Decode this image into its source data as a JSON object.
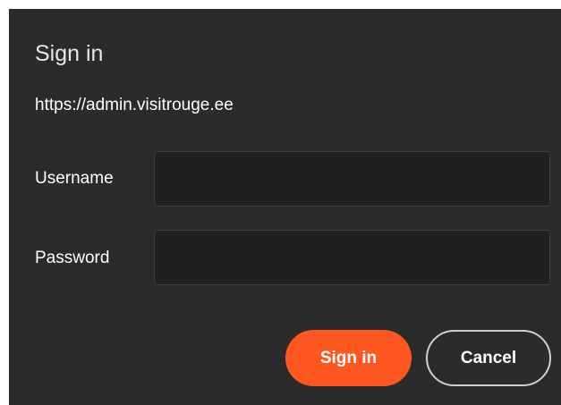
{
  "dialog": {
    "title": "Sign in",
    "url": "https://admin.visitrouge.ee",
    "username": {
      "label": "Username",
      "value": "",
      "placeholder": ""
    },
    "password": {
      "label": "Password",
      "value": "",
      "placeholder": ""
    },
    "buttons": {
      "sign_in": "Sign in",
      "cancel": "Cancel"
    }
  },
  "colors": {
    "dialog_background": "#2b2b2b",
    "input_background": "#202020",
    "primary_accent": "#ff5722",
    "text": "#ffffff"
  }
}
